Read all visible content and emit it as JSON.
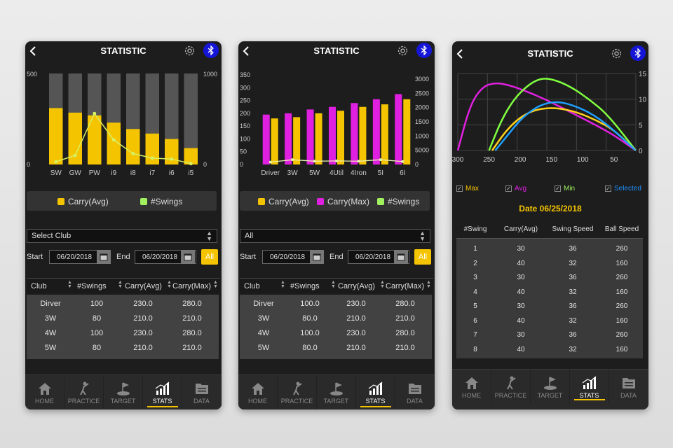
{
  "title": "STATISTIC",
  "colors": {
    "carry_avg": "#f5c400",
    "carry_max": "#e020e0",
    "swings": "#a0f060",
    "accent": "#f5c400",
    "bluetooth": "#1515d8",
    "selected": "#1e90ff"
  },
  "icons": [
    "back-icon",
    "gear-icon",
    "bluetooth-icon",
    "calendar-icon",
    "home-icon",
    "practice-icon",
    "target-icon",
    "stats-icon",
    "data-icon"
  ],
  "nav": [
    {
      "label": "HOME"
    },
    {
      "label": "PRACTICE"
    },
    {
      "label": "TARGET"
    },
    {
      "label": "STATS"
    },
    {
      "label": "DATA"
    }
  ],
  "screen1": {
    "legend": [
      "Carry(Avg)",
      "#Swings"
    ],
    "select": "Select Club",
    "start_label": "Start",
    "end_label": "End",
    "start_date": "06/20/2018",
    "end_date": "06/20/2018",
    "all_label": "All",
    "columns": [
      "Club",
      "#Swings",
      "Carry(Avg)",
      "Carry(Max)"
    ],
    "rows": [
      [
        "Dirver",
        "100",
        "230.0",
        "280.0"
      ],
      [
        "3W",
        "80",
        "210.0",
        "210.0"
      ],
      [
        "4W",
        "100",
        "230.0",
        "280.0"
      ],
      [
        "5W",
        "80",
        "210.0",
        "210.0"
      ]
    ]
  },
  "screen2": {
    "legend": [
      "Carry(Avg)",
      "Carry(Max)",
      "#Swings"
    ],
    "select": "All",
    "start_label": "Start",
    "end_label": "End",
    "start_date": "06/20/2018",
    "end_date": "06/20/2018",
    "all_label": "All",
    "columns": [
      "Club",
      "#Swings",
      "Carry(Avg)",
      "Carry(Max)"
    ],
    "rows": [
      [
        "Dirver",
        "100.0",
        "230.0",
        "280.0"
      ],
      [
        "3W",
        "80.0",
        "210.0",
        "210.0"
      ],
      [
        "4W",
        "100.0",
        "230.0",
        "280.0"
      ],
      [
        "5W",
        "80.0",
        "210.0",
        "210.0"
      ]
    ]
  },
  "screen3": {
    "checkboxes": [
      {
        "label": "Max",
        "color": "#f5c400"
      },
      {
        "label": "Avg",
        "color": "#e020e0"
      },
      {
        "label": "Min",
        "color": "#a0f060"
      },
      {
        "label": "Selected",
        "color": "#1e90ff"
      }
    ],
    "date_text": "Date 06/25/2018",
    "columns": [
      "#Swing",
      "Carry(Avg)",
      "Swing Speed",
      "Ball Speed"
    ],
    "rows": [
      [
        "1",
        "30",
        "36",
        "260"
      ],
      [
        "2",
        "40",
        "32",
        "160"
      ],
      [
        "3",
        "30",
        "36",
        "260"
      ],
      [
        "4",
        "40",
        "32",
        "160"
      ],
      [
        "5",
        "30",
        "36",
        "260"
      ],
      [
        "6",
        "40",
        "32",
        "160"
      ],
      [
        "7",
        "30",
        "36",
        "260"
      ],
      [
        "8",
        "40",
        "32",
        "160"
      ]
    ]
  },
  "chart_data": [
    {
      "type": "bar",
      "categories": [
        "SW",
        "GW",
        "PW",
        "i9",
        "i8",
        "i7",
        "i6",
        "i5"
      ],
      "yticks_left": [
        "500",
        "0"
      ],
      "yticks_right": [
        "1000",
        "0"
      ],
      "ylim_left": [
        0,
        500
      ],
      "ylim_right": [
        0,
        1000
      ],
      "series": [
        {
          "name": "Carry(Avg)",
          "type": "bar",
          "axis": "left",
          "color": "#f5c400",
          "values": [
            310,
            285,
            270,
            230,
            195,
            170,
            140,
            90
          ]
        },
        {
          "name": "#Swings",
          "type": "line",
          "axis": "right",
          "color": "#d8f060",
          "values": [
            30,
            100,
            560,
            270,
            120,
            70,
            60,
            10
          ]
        }
      ],
      "background_bars": true
    },
    {
      "type": "bar",
      "categories": [
        "Driver",
        "3W",
        "5W",
        "4Util",
        "4Iron",
        "5I",
        "6I"
      ],
      "yticks_left": [
        "350",
        "300",
        "250",
        "200",
        "150",
        "100",
        "50",
        "0"
      ],
      "yticks_right": [
        "3000",
        "2500",
        "2000",
        "1500",
        "1000",
        "5000",
        "0"
      ],
      "ylim_left": [
        0,
        350
      ],
      "ylim_right": [
        0,
        3000
      ],
      "series": [
        {
          "name": "Carry(Max)",
          "type": "bar",
          "axis": "left",
          "color": "#e020e0",
          "values": [
            195,
            200,
            215,
            225,
            240,
            255,
            275
          ]
        },
        {
          "name": "Carry(Avg)",
          "type": "bar",
          "axis": "left",
          "color": "#f5c400",
          "values": [
            180,
            185,
            200,
            210,
            225,
            235,
            255
          ]
        },
        {
          "name": "#Swings",
          "type": "line",
          "axis": "right",
          "color": "#e8f0b0",
          "values": [
            80,
            160,
            110,
            120,
            110,
            160,
            100
          ]
        }
      ]
    },
    {
      "type": "line",
      "x_ticks": [
        "300",
        "250",
        "200",
        "150",
        "100",
        "50"
      ],
      "x_values": [
        300,
        250,
        200,
        150,
        100,
        50
      ],
      "xlim": [
        300,
        15
      ],
      "yticks_right": [
        "15",
        "10",
        "5",
        "0"
      ],
      "ylim": [
        0,
        15
      ],
      "grid": true,
      "series": [
        {
          "name": "Max",
          "color": "#e020e0",
          "x": [
            300,
            280,
            260,
            240,
            220,
            200,
            160,
            120,
            80,
            50,
            15
          ],
          "y": [
            0,
            9,
            12.5,
            13.2,
            12.8,
            12,
            10,
            7.5,
            5,
            3,
            0
          ]
        },
        {
          "name": "Min",
          "color": "#80ff40",
          "x": [
            250,
            230,
            210,
            190,
            170,
            150,
            120,
            90,
            60,
            15
          ],
          "y": [
            0,
            6,
            10,
            12.5,
            14,
            14,
            12.5,
            10,
            7,
            0
          ]
        },
        {
          "name": "Avg",
          "color": "#ffd21a",
          "x": [
            245,
            225,
            205,
            185,
            165,
            140,
            110,
            80,
            50,
            15
          ],
          "y": [
            0,
            3.5,
            6,
            7.5,
            8.2,
            8.3,
            7.5,
            6,
            4,
            0
          ]
        },
        {
          "name": "Selected",
          "color": "#1ea0ff",
          "x": [
            240,
            220,
            200,
            180,
            160,
            140,
            120,
            90,
            60,
            15
          ],
          "y": [
            0,
            3,
            6,
            8,
            9.2,
            9.5,
            9,
            7.5,
            5,
            0
          ]
        }
      ]
    }
  ]
}
